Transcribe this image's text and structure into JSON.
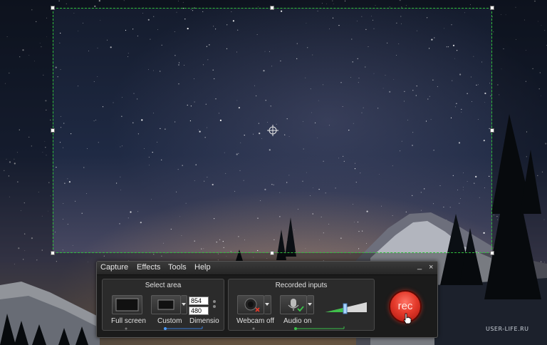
{
  "menu": {
    "items": [
      "Capture",
      "Effects",
      "Tools",
      "Help"
    ]
  },
  "window_buttons": {
    "minimize": "_",
    "close": "×"
  },
  "select_area": {
    "title": "Select area",
    "full_screen_label": "Full screen",
    "custom_label": "Custom",
    "dimensions_label": "Dimensio",
    "width": "854",
    "height": "480"
  },
  "recorded_inputs": {
    "title": "Recorded inputs",
    "webcam_label": "Webcam off",
    "audio_label": "Audio on"
  },
  "rec_button": {
    "label": "rec"
  },
  "watermark": "USER-LIFE.RU",
  "colors": {
    "selection": "#2fbf3a",
    "rec": "#e43a2b",
    "toolbar": "#1b1b1b"
  }
}
